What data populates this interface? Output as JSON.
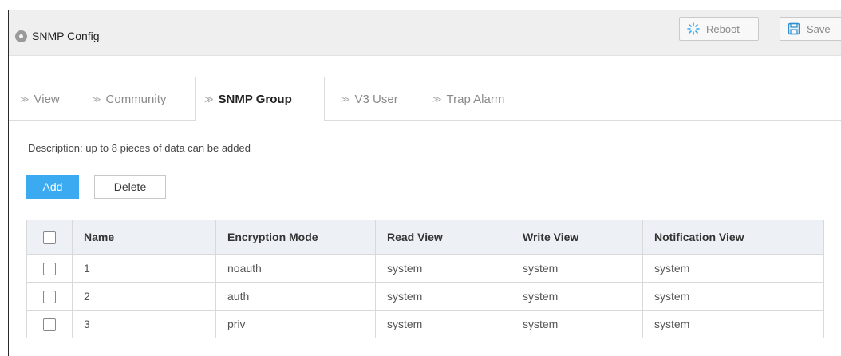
{
  "header": {
    "title": "SNMP Config",
    "reboot_label": "Reboot",
    "save_label": "Save"
  },
  "tabs": [
    {
      "label": "View",
      "active": false
    },
    {
      "label": "Community",
      "active": false
    },
    {
      "label": "SNMP Group",
      "active": true
    },
    {
      "label": "V3 User",
      "active": false
    },
    {
      "label": "Trap Alarm",
      "active": false
    }
  ],
  "description": "Description: up to 8 pieces of data can be added",
  "actions": {
    "add_label": "Add",
    "delete_label": "Delete"
  },
  "table": {
    "columns": [
      "Name",
      "Encryption Mode",
      "Read View",
      "Write View",
      "Notification View"
    ],
    "rows": [
      [
        "1",
        "noauth",
        "system",
        "system",
        "system"
      ],
      [
        "2",
        "auth",
        "system",
        "system",
        "system"
      ],
      [
        "3",
        "priv",
        "system",
        "system",
        "system"
      ]
    ]
  },
  "colors": {
    "accent": "#3baaf0",
    "header_bg": "#efefef",
    "table_header_bg": "#edf1f6"
  },
  "icons": {
    "header": "circle-dot-icon",
    "reboot": "spinner-icon",
    "save": "floppy-disk-icon",
    "tab": "chevron-right-icon"
  }
}
